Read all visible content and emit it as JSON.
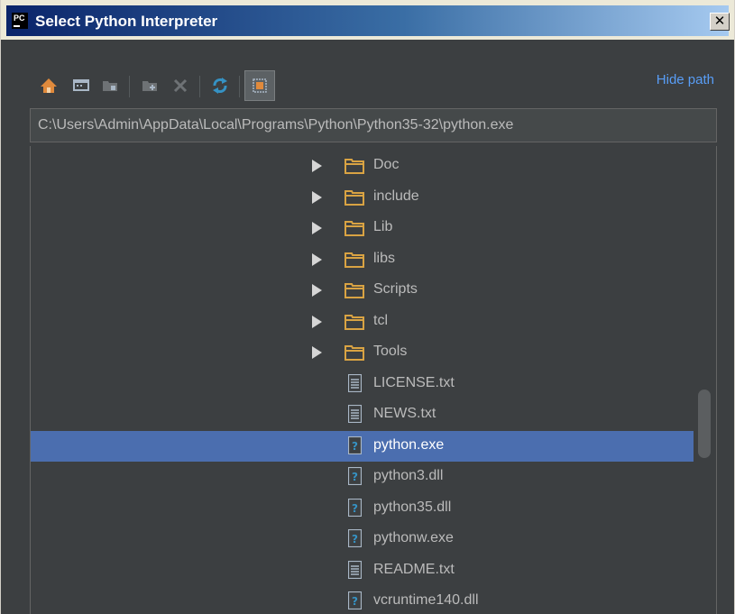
{
  "window": {
    "app_icon_text": "PC",
    "title": "Select Python Interpreter",
    "close_label": "x"
  },
  "toolbar": {
    "buttons": [
      {
        "name": "home-icon"
      },
      {
        "name": "desktop-icon"
      },
      {
        "name": "project-folder-icon"
      },
      {
        "name": "new-folder-icon"
      },
      {
        "name": "delete-icon"
      },
      {
        "name": "refresh-icon"
      },
      {
        "name": "show-hidden-files-icon"
      }
    ],
    "hide_path_label": "Hide path"
  },
  "path": {
    "value": "C:\\Users\\Admin\\AppData\\Local\\Programs\\Python\\Python35-32\\python.exe"
  },
  "tree": {
    "items": [
      {
        "label": "Doc",
        "type": "folder"
      },
      {
        "label": "include",
        "type": "folder"
      },
      {
        "label": "Lib",
        "type": "folder"
      },
      {
        "label": "libs",
        "type": "folder"
      },
      {
        "label": "Scripts",
        "type": "folder"
      },
      {
        "label": "tcl",
        "type": "folder"
      },
      {
        "label": "Tools",
        "type": "folder"
      },
      {
        "label": "LICENSE.txt",
        "type": "text-file"
      },
      {
        "label": "NEWS.txt",
        "type": "text-file"
      },
      {
        "label": "python.exe",
        "type": "unknown-file",
        "selected": true
      },
      {
        "label": "python3.dll",
        "type": "unknown-file"
      },
      {
        "label": "python35.dll",
        "type": "unknown-file"
      },
      {
        "label": "pythonw.exe",
        "type": "unknown-file"
      },
      {
        "label": "README.txt",
        "type": "text-file"
      },
      {
        "label": "vcruntime140.dll",
        "type": "unknown-file"
      }
    ]
  },
  "colors": {
    "background": "#3c3f41",
    "selection": "#4b6eaf",
    "link": "#589df6",
    "folder": "#d9a343",
    "text": "#bbbbbb"
  }
}
